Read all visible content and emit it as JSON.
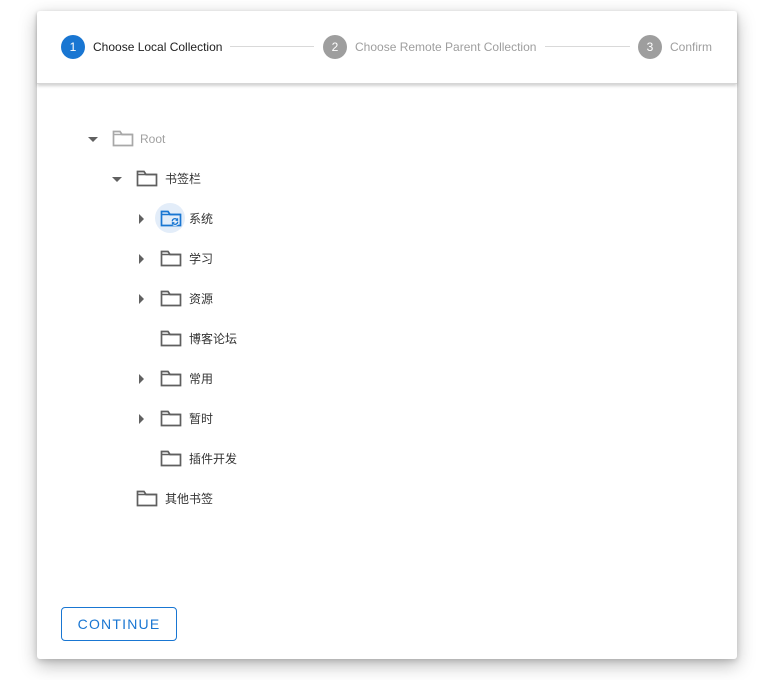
{
  "stepper": {
    "steps": [
      {
        "number": "1",
        "label": "Choose Local Collection",
        "active": true
      },
      {
        "number": "2",
        "label": "Choose Remote Parent Collection",
        "active": false
      },
      {
        "number": "3",
        "label": "Confirm",
        "active": false
      }
    ]
  },
  "tree": {
    "root": {
      "label": "Root",
      "expanded": true
    },
    "bookmarks_bar": {
      "label": "书签栏",
      "expanded": true
    },
    "children": [
      {
        "label": "系统",
        "has_children": true,
        "icon": "folder-sync-icon"
      },
      {
        "label": "学习",
        "has_children": true,
        "icon": "folder-icon"
      },
      {
        "label": "资源",
        "has_children": true,
        "icon": "folder-icon"
      },
      {
        "label": "博客论坛",
        "has_children": false,
        "icon": "folder-icon"
      },
      {
        "label": "常用",
        "has_children": true,
        "icon": "folder-icon"
      },
      {
        "label": "暂时",
        "has_children": true,
        "icon": "folder-icon"
      },
      {
        "label": "插件开发",
        "has_children": false,
        "icon": "folder-icon"
      }
    ],
    "other_bookmarks": {
      "label": "其他书签"
    }
  },
  "actions": {
    "continue_label": "CONTINUE"
  },
  "colors": {
    "primary": "#1976d2",
    "inactive": "#9e9e9e",
    "folder": "#5f5f5f"
  }
}
